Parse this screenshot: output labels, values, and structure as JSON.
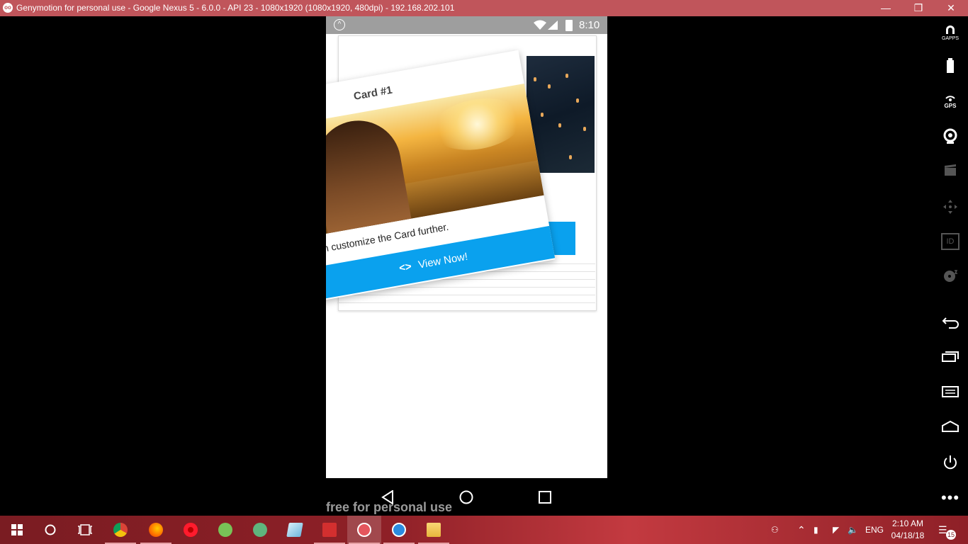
{
  "window": {
    "title": "Genymotion for personal use - Google Nexus 5 - 6.0.0 - API 23 - 1080x1920 (1080x1920, 480dpi) - 192.168.202.101"
  },
  "device": {
    "status_time": "8:10",
    "front_card": {
      "title": "Card #1",
      "text": "n customize the Card further.",
      "button_label": "View Now!",
      "button_icon": "<>"
    },
    "watermark": "free for personal use"
  },
  "side_toolbar": {
    "gapps_label": "GAPPS",
    "gps_label": "GPS",
    "id_label": "ID"
  },
  "taskbar": {
    "language": "ENG",
    "time": "2:10 AM",
    "date": "04/18/18",
    "notifications": "15"
  },
  "colors": {
    "titlebar": "#c0555b",
    "accent_button": "#0aa1ee",
    "taskbar": "#8e2027"
  }
}
